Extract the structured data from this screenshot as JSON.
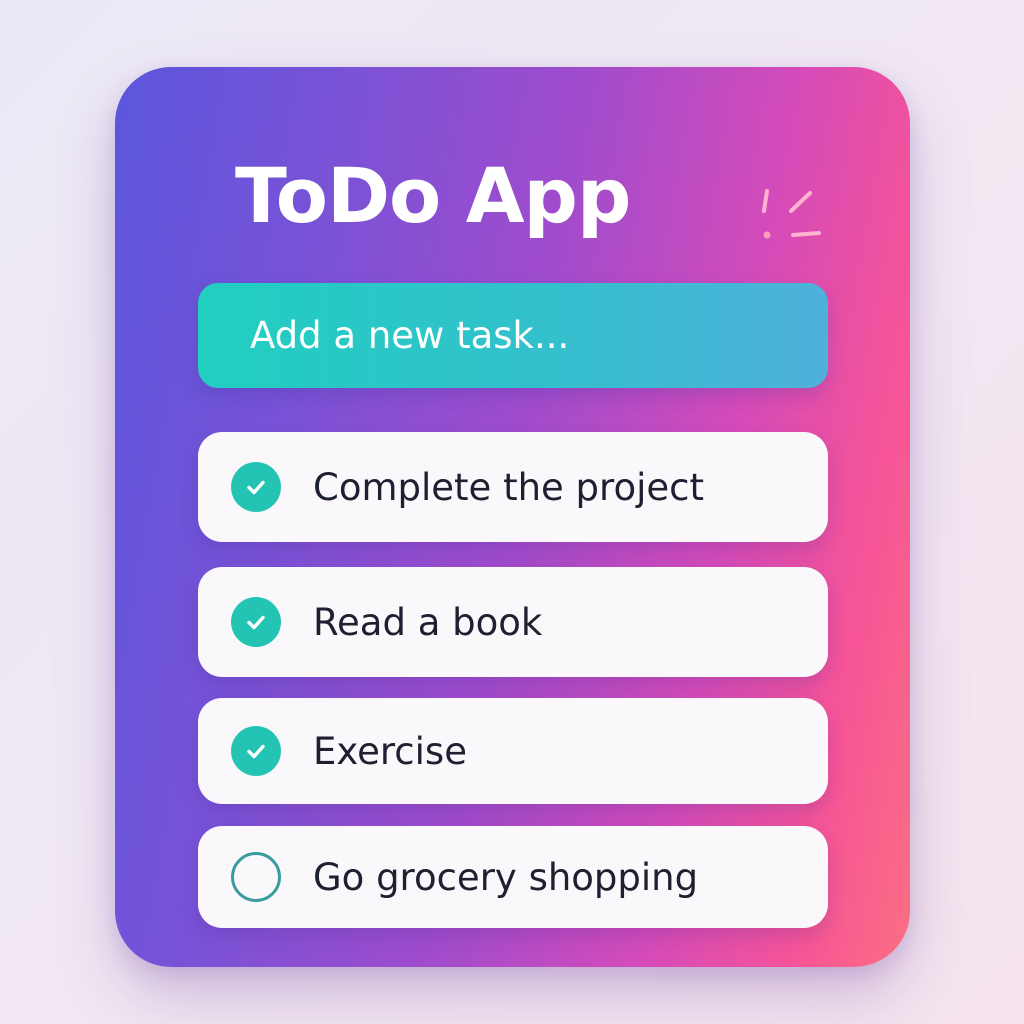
{
  "app": {
    "title": "ToDo App"
  },
  "new_task": {
    "placeholder": "Add a new task..."
  },
  "tasks": [
    {
      "label": "Complete the project",
      "completed": true
    },
    {
      "label": "Read a book",
      "completed": true
    },
    {
      "label": "Exercise",
      "completed": true
    },
    {
      "label": "Go grocery shopping",
      "completed": false
    }
  ],
  "icons": {
    "completed": "check-circle-icon",
    "pending": "empty-circle-icon",
    "decoration": "sparkle-icon"
  },
  "colors": {
    "accent": "#23c4b4",
    "card_gradient_start": "#5b56dc",
    "card_gradient_end": "#fb6f82",
    "task_text": "#1d2030",
    "task_background": "#fbf8fc"
  }
}
